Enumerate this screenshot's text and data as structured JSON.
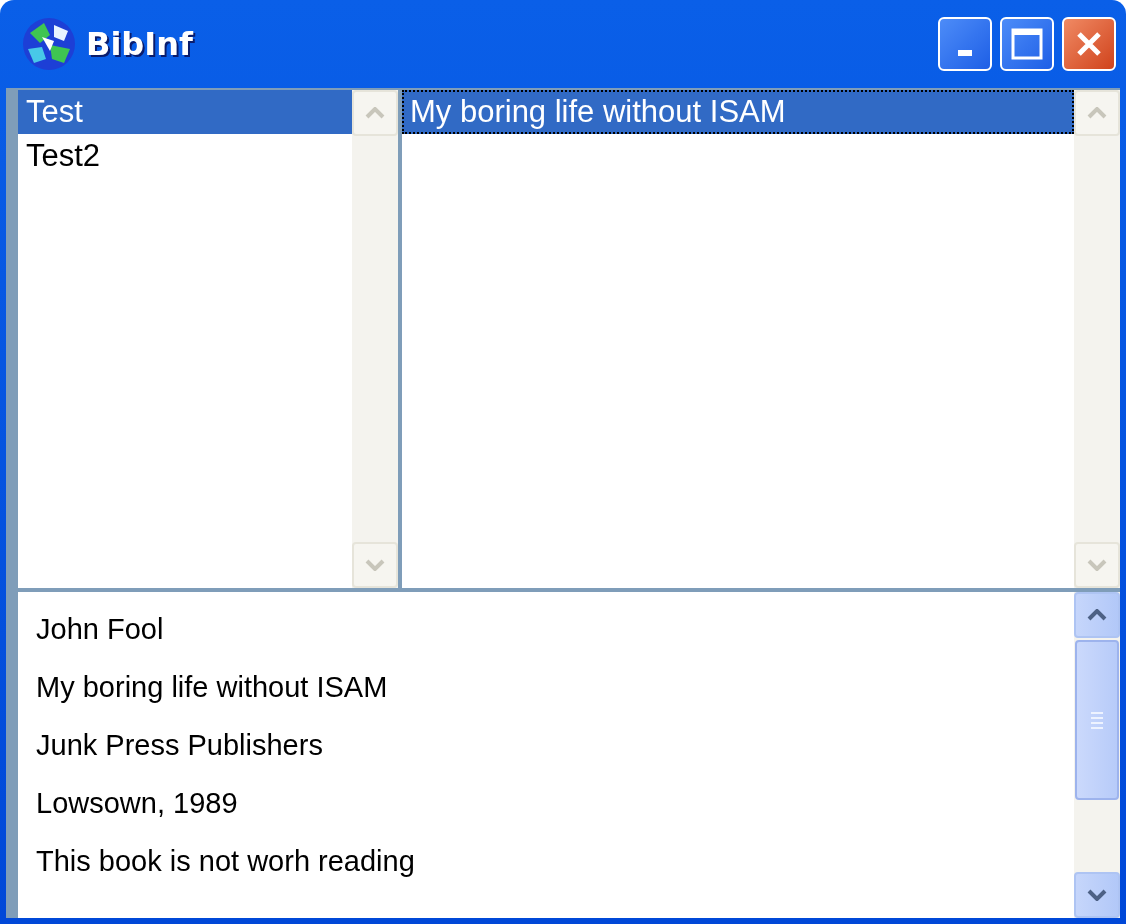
{
  "window": {
    "title": "BibInf"
  },
  "categories": [
    {
      "label": "Test",
      "selected": true
    },
    {
      "label": "Test2",
      "selected": false
    }
  ],
  "books": [
    {
      "label": "My boring life without ISAM",
      "selected": true
    }
  ],
  "details": {
    "lines": [
      "John Fool",
      "My boring life without ISAM",
      "Junk Press Publishers",
      "Lowsown, 1989",
      "This book is not worh reading"
    ]
  }
}
